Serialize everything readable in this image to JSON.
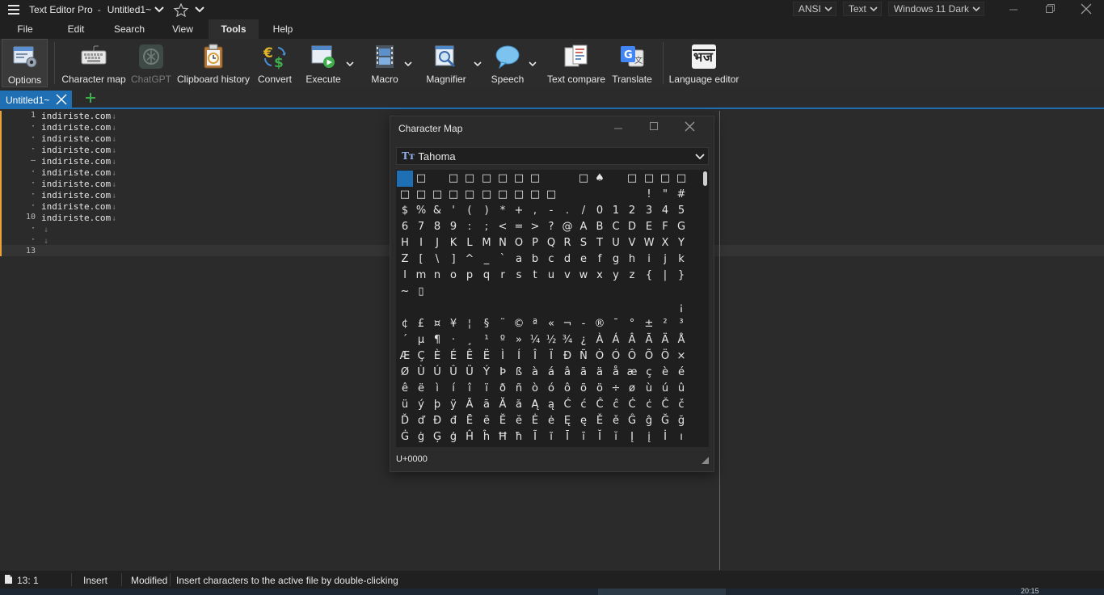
{
  "window": {
    "app_title": "Text Editor Pro",
    "separator": "-",
    "doc_title": "Untitled1~",
    "encoding": "ANSI",
    "syntax": "Text",
    "theme": "Windows 11 Dark"
  },
  "menu": [
    "File",
    "Edit",
    "Search",
    "View",
    "Tools",
    "Help"
  ],
  "menu_active": "Tools",
  "toolbar": {
    "options": "Options",
    "character_map": "Character map",
    "chatgpt": "ChatGPT",
    "clipboard_history": "Clipboard history",
    "convert": "Convert",
    "execute": "Execute",
    "macro": "Macro",
    "magnifier": "Magnifier",
    "speech": "Speech",
    "text_compare": "Text compare",
    "translate": "Translate",
    "language_editor": "Language editor"
  },
  "tabs": [
    {
      "label": "Untitled1~",
      "active": true
    }
  ],
  "editor": {
    "gutter": [
      "1",
      "·",
      "·",
      "·",
      "–",
      "·",
      "·",
      "·",
      "·",
      "10",
      "·",
      "·",
      "13"
    ],
    "lines": [
      "indiriste.com",
      "indiriste.com",
      "indiriste.com",
      "indiriste.com",
      "indiriste.com",
      "indiriste.com",
      "indiriste.com",
      "indiriste.com",
      "indiriste.com",
      "indiriste.com",
      "",
      "",
      ""
    ],
    "eol_marker": "↓"
  },
  "charmap": {
    "title": "Character Map",
    "font": "Tahoma",
    "font_icon": "Tт",
    "code": "U+0000",
    "rows": [
      [
        "",
        "□",
        "",
        "□",
        "□",
        "□",
        "□",
        "□",
        "□",
        "",
        "",
        "□",
        "♠",
        "",
        "□",
        "□",
        "□",
        "□"
      ],
      [
        "□",
        "□",
        "□",
        "□",
        "□",
        "□",
        "□",
        "□",
        "□",
        "□",
        "",
        "",
        "",
        "",
        "",
        "!",
        "\"",
        "#"
      ],
      [
        "$",
        "%",
        "&",
        "'",
        "(",
        ")",
        "*",
        "+",
        ",",
        "-",
        ".",
        "/",
        "0",
        "1",
        "2",
        "3",
        "4",
        "5"
      ],
      [
        "6",
        "7",
        "8",
        "9",
        ":",
        ";",
        "<",
        "=",
        ">",
        "?",
        "@",
        "A",
        "B",
        "C",
        "D",
        "E",
        "F",
        "G"
      ],
      [
        "H",
        "I",
        "J",
        "K",
        "L",
        "M",
        "N",
        "O",
        "P",
        "Q",
        "R",
        "S",
        "T",
        "U",
        "V",
        "W",
        "X",
        "Y"
      ],
      [
        "Z",
        "[",
        "\\",
        "]",
        "^",
        "_",
        "`",
        "a",
        "b",
        "c",
        "d",
        "e",
        "f",
        "g",
        "h",
        "i",
        "j",
        "k"
      ],
      [
        "l",
        "m",
        "n",
        "o",
        "p",
        "q",
        "r",
        "s",
        "t",
        "u",
        "v",
        "w",
        "x",
        "y",
        "z",
        "{",
        "|",
        "}"
      ],
      [
        "~",
        "▯",
        "",
        "",
        "",
        "",
        "",
        "",
        "",
        "",
        "",
        "",
        "",
        "",
        "",
        "",
        "",
        ""
      ],
      [
        "",
        "",
        "",
        "",
        "",
        "",
        "",
        "",
        "",
        "",
        "",
        "",
        "",
        "",
        "",
        "",
        "",
        "¡"
      ],
      [
        "¢",
        "£",
        "¤",
        "¥",
        "¦",
        "§",
        "¨",
        "©",
        "ª",
        "«",
        "¬",
        "-",
        "®",
        "¯",
        "°",
        "±",
        "²",
        "³"
      ],
      [
        "´",
        "µ",
        "¶",
        "·",
        "¸",
        "¹",
        "º",
        "»",
        "¼",
        "½",
        "¾",
        "¿",
        "À",
        "Á",
        "Â",
        "Ã",
        "Ä",
        "Å"
      ],
      [
        "Æ",
        "Ç",
        "È",
        "É",
        "Ê",
        "Ë",
        "Ì",
        "Í",
        "Î",
        "Ï",
        "Ð",
        "Ñ",
        "Ò",
        "Ó",
        "Ô",
        "Õ",
        "Ö",
        "×"
      ],
      [
        "Ø",
        "Ù",
        "Ú",
        "Û",
        "Ü",
        "Ý",
        "Þ",
        "ß",
        "à",
        "á",
        "â",
        "ã",
        "ä",
        "å",
        "æ",
        "ç",
        "è",
        "é"
      ],
      [
        "ê",
        "ë",
        "ì",
        "í",
        "î",
        "ï",
        "ð",
        "ñ",
        "ò",
        "ó",
        "ô",
        "õ",
        "ö",
        "÷",
        "ø",
        "ù",
        "ú",
        "û"
      ],
      [
        "ü",
        "ý",
        "þ",
        "ÿ",
        "Ā",
        "ā",
        "Ă",
        "ă",
        "Ą",
        "ą",
        "Ć",
        "ć",
        "Ĉ",
        "ĉ",
        "Ċ",
        "ċ",
        "Č",
        "č"
      ],
      [
        "Ď",
        "ď",
        "Đ",
        "đ",
        "Ē",
        "ē",
        "Ĕ",
        "ĕ",
        "Ė",
        "ė",
        "Ę",
        "ę",
        "Ě",
        "ě",
        "Ĝ",
        "ĝ",
        "Ğ",
        "ğ"
      ],
      [
        "Ġ",
        "ġ",
        "Ģ",
        "ģ",
        "Ĥ",
        "ĥ",
        "Ħ",
        "ħ",
        "Ĩ",
        "ĩ",
        "Ī",
        "ī",
        "Ĭ",
        "ĭ",
        "Į",
        "į",
        "İ",
        "ı"
      ]
    ]
  },
  "status": {
    "position": "13: 1",
    "mode": "Insert",
    "modified": "Modified",
    "hint": "Insert characters to the active file by double-clicking"
  },
  "taskbar": {
    "clock": "20:15"
  },
  "colors": {
    "accent": "#1f6fb5",
    "background": "#2b2b2b",
    "chrome": "#202020",
    "modified_marker": "#e8a33a"
  }
}
